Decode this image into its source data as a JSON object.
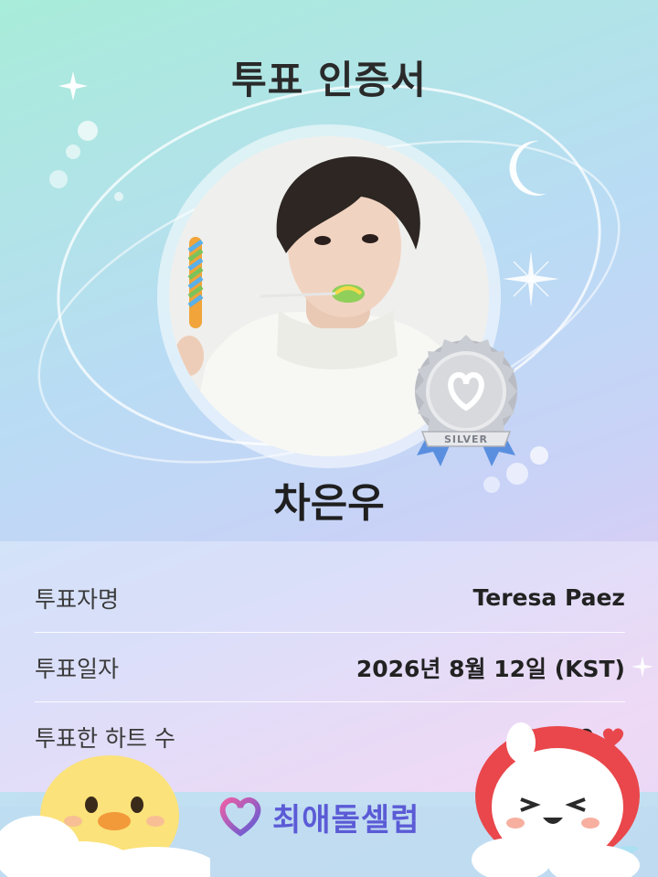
{
  "certificate": {
    "title": "투표 인증서",
    "idol_name": "차은우",
    "badge_tier": "SILVER"
  },
  "info": {
    "voter_label": "투표자명",
    "voter_value": "Teresa Paez",
    "date_label": "투표일자",
    "date_value": "2026년 8월 12일 (KST)",
    "hearts_label": "투표한 하트 수",
    "hearts_value": "1,280"
  },
  "brand": {
    "name": "최애돌셀럽"
  },
  "colors": {
    "brand": "#5b5bd6",
    "heart": "#e8474c",
    "badge_ribbon": "#5a8fe0",
    "badge_silver": "#c9ccd2"
  },
  "icons": [
    "sparkle-icon",
    "moon-icon",
    "heart-icon",
    "brand-logo-icon"
  ]
}
